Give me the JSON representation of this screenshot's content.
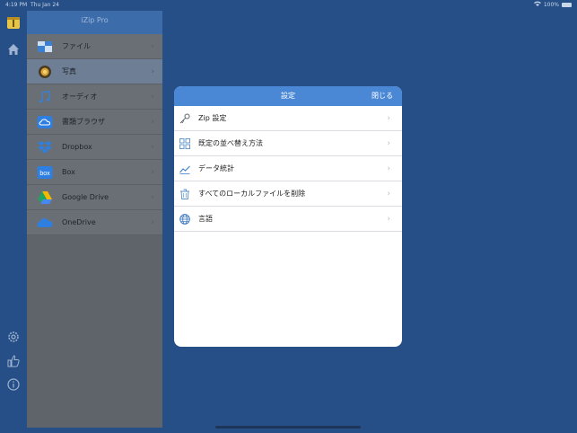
{
  "status": {
    "time": "4:19 PM",
    "date": "Thu Jan 24",
    "battery": "100%"
  },
  "app": {
    "title": "iZip Pro"
  },
  "rail": {
    "icons": [
      "app-logo-icon",
      "home-icon",
      "settings-gear-icon",
      "thumbs-up-icon",
      "info-icon"
    ]
  },
  "sidebar": {
    "items": [
      {
        "label": "ファイル",
        "icon": "files-icon"
      },
      {
        "label": "写真",
        "icon": "photos-icon"
      },
      {
        "label": "オーディオ",
        "icon": "music-note-icon"
      },
      {
        "label": "書類ブラウザ",
        "icon": "cloud-folder-icon"
      },
      {
        "label": "Dropbox",
        "icon": "dropbox-icon"
      },
      {
        "label": "Box",
        "icon": "box-icon"
      },
      {
        "label": "Google Drive",
        "icon": "google-drive-icon"
      },
      {
        "label": "OneDrive",
        "icon": "onedrive-icon"
      }
    ],
    "selected_index": 1
  },
  "settings": {
    "title": "設定",
    "close_label": "閉じる",
    "rows": [
      {
        "label": "Zip 設定",
        "icon": "key-icon"
      },
      {
        "label": "既定の並べ替え方法",
        "icon": "grid-icon"
      },
      {
        "label": "データ統計",
        "icon": "line-chart-icon"
      },
      {
        "label": "すべてのローカルファイルを削除",
        "icon": "trash-icon"
      },
      {
        "label": "言語",
        "icon": "globe-icon"
      }
    ]
  },
  "colors": {
    "background": "#254f86",
    "accent": "#4a88d6",
    "sidebar_header": "#3d6cab"
  }
}
